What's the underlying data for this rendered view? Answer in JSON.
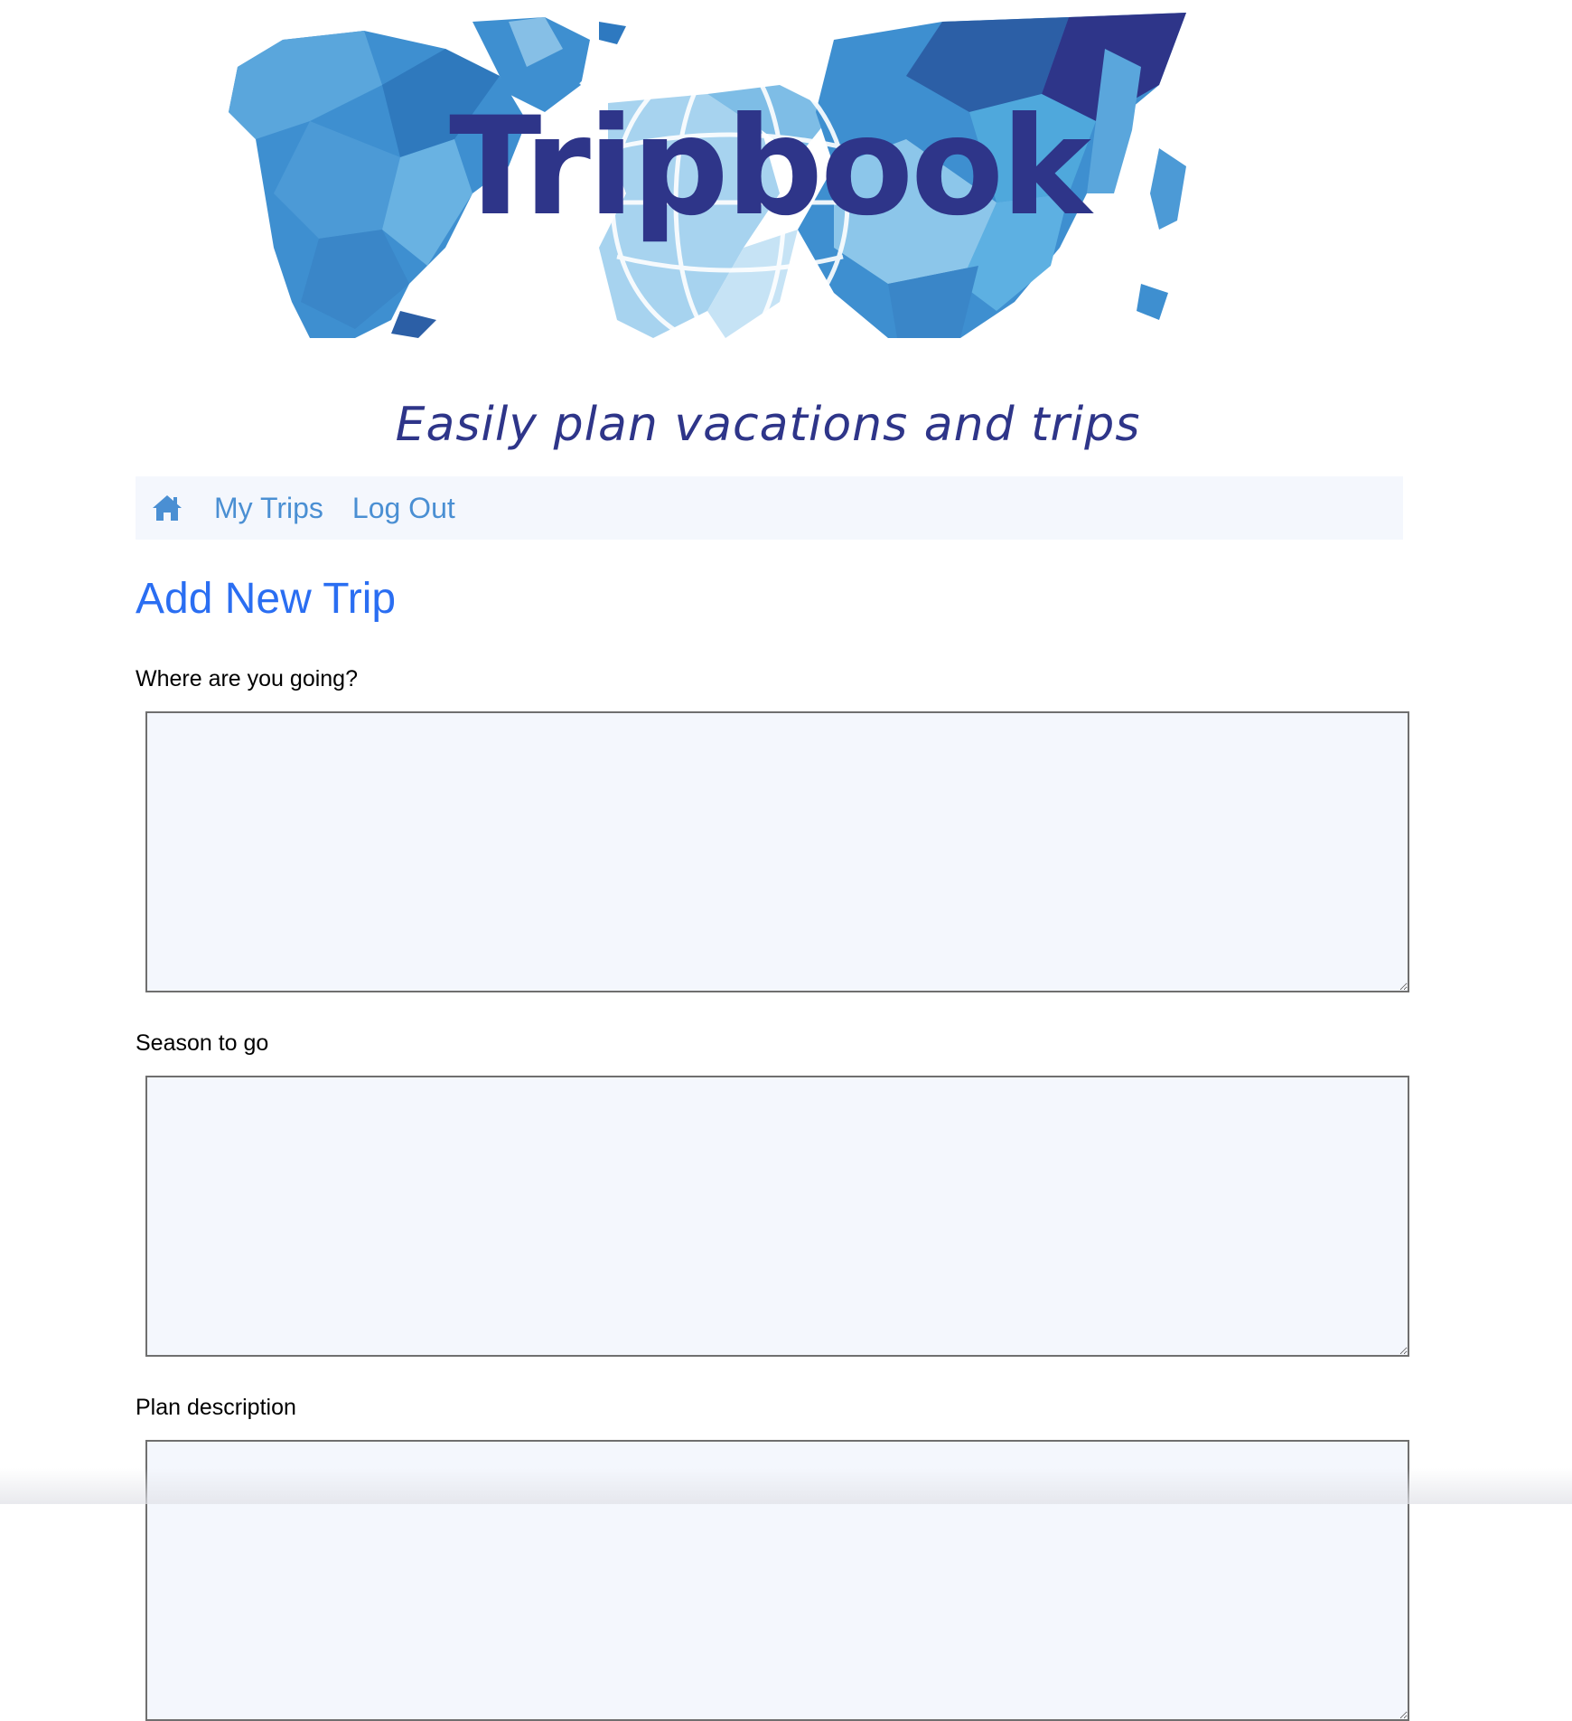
{
  "brand": {
    "logo_text": "Tripbook",
    "tagline": "Easily plan vacations and trips",
    "logo_color": "#2e3589",
    "banner_palette": [
      "#3e8fd0",
      "#2c5fa6",
      "#8cc6ea",
      "#2e3589"
    ]
  },
  "nav": {
    "home_icon": "home-icon",
    "items": [
      {
        "label": "My Trips"
      },
      {
        "label": "Log Out"
      }
    ],
    "link_color": "#4a8fd3"
  },
  "page": {
    "title": "Add New Trip",
    "title_color": "#2a6ef2"
  },
  "form": {
    "fields": [
      {
        "label": "Where are you going?",
        "value": ""
      },
      {
        "label": "Season to go",
        "value": ""
      },
      {
        "label": "Plan description",
        "value": ""
      }
    ]
  }
}
